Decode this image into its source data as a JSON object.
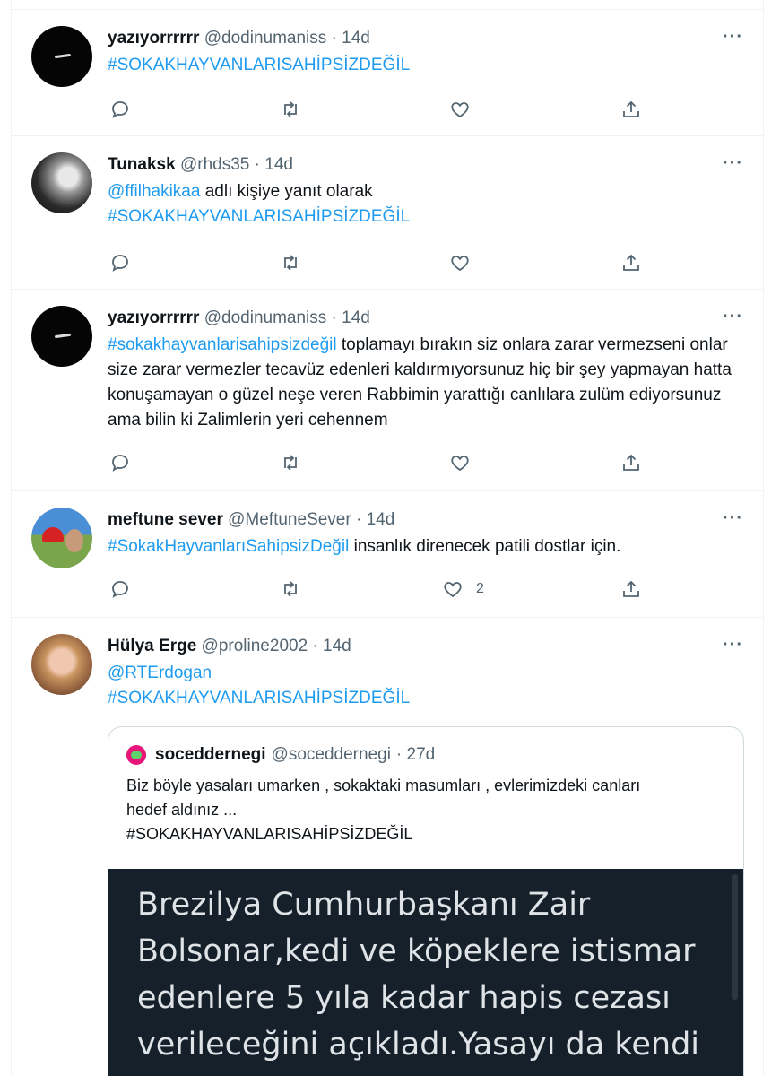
{
  "tweets": [
    {
      "name": "yazıyorrrrrr",
      "handle": "@dodinumaniss",
      "time": "· 14d",
      "more": "···",
      "hashtag": "#SOKAKHAYVANLARISAHİPSİZDEĞİL"
    },
    {
      "name": "Tunaksk",
      "handle": "@rhds35",
      "time": "· 14d",
      "more": "···",
      "reply_to_user": "@ffilhakikaa",
      "reply_suffix": "adlı kişiye yanıt olarak",
      "hashtag": "#SOKAKHAYVANLARISAHİPSİZDEĞİL"
    },
    {
      "name": "yazıyorrrrrr",
      "handle": "@dodinumaniss",
      "time": "· 14d",
      "more": "···",
      "hashtag": "#sokakhayvanlarisahipsizdeğil",
      "text": "toplamayı bırakın siz onlara zarar vermezseni onlar size zarar vermezler tecavüz edenleri kaldırmıyorsunuz hiç bir şey yapmayan hatta konuşamayan o güzel neşe veren Rabbimin yarattığı canlılara zulüm ediyorsunuz ama bilin ki Zalimlerin yeri cehennem"
    },
    {
      "name": "meftune sever",
      "handle": "@MeftuneSever",
      "time": "· 14d",
      "more": "···",
      "hashtag": "#SokakHayvanlarıSahipsizDeğil",
      "text": "insanlık direnecek patili dostlar için.",
      "like_count": "2"
    },
    {
      "name": "Hülya Erge",
      "handle": "@proline2002",
      "time": "· 14d",
      "more": "···",
      "mention": "@RTErdogan",
      "hashtag": "#SOKAKHAYVANLARISAHİPSİZDEĞİL"
    }
  ],
  "quote": {
    "name": "soceddernegi",
    "handle": "@soceddernegi",
    "time": "· 27d",
    "text_line1": "Biz böyle yasaları umarken , sokaktaki masumları , evlerimizdeki canları",
    "text_line2": "hedef aldınız ...",
    "text_line3": "#SOKAKHAYVANLARISAHİPSİZDEĞİL",
    "image_text": "Brezilya Cumhurbaşkanı Zair Bolsonar,kedi ve köpeklere istismar edenlere 5 yıla kadar hapis cezası verileceğini açıkladı.Yasayı da kendi"
  },
  "icons": {
    "reply": "reply-icon",
    "retweet": "retweet-icon",
    "like": "like-icon",
    "share": "share-icon",
    "more": "more-icon"
  },
  "colors": {
    "link": "#1d9bf0",
    "secondary_text": "#536471",
    "border": "#eff3f4",
    "quote_image_bg": "#15202b"
  }
}
